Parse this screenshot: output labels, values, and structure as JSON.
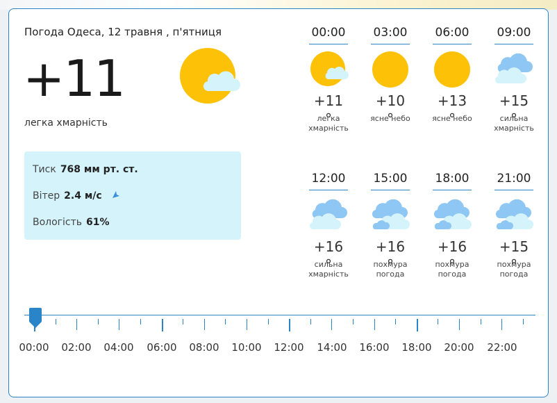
{
  "header": {
    "title": "Погода Одеса, 12 травня , п'ятниця",
    "temperature": "+11",
    "condition": "легка хмарність",
    "icon": "sun-with-cloud-icon"
  },
  "details": {
    "pressure_label": "Тиск",
    "pressure_value": "768 мм рт. ст.",
    "wind_label": "Вітер",
    "wind_value": "2.4 м/с",
    "wind_icon": "wind-direction-arrow-icon",
    "humidity_label": "Вологість",
    "humidity_value": "61%"
  },
  "forecast": [
    {
      "time": "00:00",
      "temp": "+11 °",
      "desc_1": "легка",
      "desc_2": "хмарність",
      "icon": "sun-cloud-icon"
    },
    {
      "time": "03:00",
      "temp": "+10 °",
      "desc_1": "ясне небо",
      "desc_2": "",
      "icon": "sun-icon"
    },
    {
      "time": "06:00",
      "temp": "+13 °",
      "desc_1": "ясне небо",
      "desc_2": "",
      "icon": "sun-icon"
    },
    {
      "time": "09:00",
      "temp": "+15 °",
      "desc_1": "сильна",
      "desc_2": "хмарність",
      "icon": "clouds-icon"
    },
    {
      "time": "12:00",
      "temp": "+16 °",
      "desc_1": "сильна",
      "desc_2": "хмарність",
      "icon": "clouds-icon"
    },
    {
      "time": "15:00",
      "temp": "+16 °",
      "desc_1": "похмура",
      "desc_2": "погода",
      "icon": "overcast-icon"
    },
    {
      "time": "18:00",
      "temp": "+16 °",
      "desc_1": "похмура",
      "desc_2": "погода",
      "icon": "overcast-icon"
    },
    {
      "time": "21:00",
      "temp": "+15 °",
      "desc_1": "похмура",
      "desc_2": "погода",
      "icon": "overcast-icon"
    }
  ],
  "timeline": {
    "labels": [
      "00:00",
      "02:00",
      "04:00",
      "06:00",
      "08:00",
      "10:00",
      "12:00",
      "14:00",
      "16:00",
      "18:00",
      "20:00",
      "22:00"
    ],
    "selected": "00:00"
  },
  "colors": {
    "accent": "#2a84c8",
    "sun": "#fdc107",
    "cloud_light": "#d4f3fb",
    "cloud_dark": "#8ec7f3",
    "info_bg": "#d4f3fb"
  }
}
